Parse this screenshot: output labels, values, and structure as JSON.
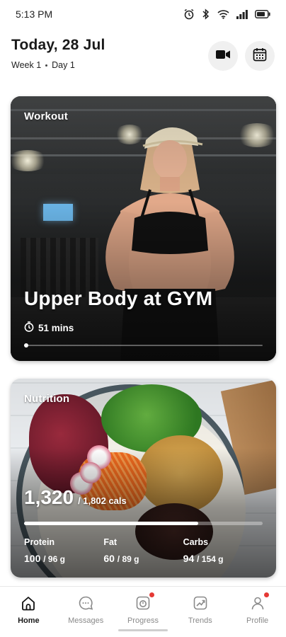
{
  "status_bar": {
    "time": "5:13 PM",
    "icons": [
      "alarm-icon",
      "bluetooth-icon",
      "wifi-icon",
      "cellular-signal-icon",
      "battery-icon"
    ]
  },
  "header": {
    "date": "Today, 28 Jul",
    "week": "Week 1",
    "day": "Day 1",
    "buttons": [
      "video-camera-icon",
      "calendar-icon"
    ]
  },
  "workout": {
    "label": "Workout",
    "title": "Upper Body at GYM",
    "duration": "51 mins"
  },
  "nutrition": {
    "label": "Nutrition",
    "calories": "1,320",
    "calories_target": "/ 1,802 cals",
    "calories_progress": 0.73,
    "macros": [
      {
        "name": "Protein",
        "value": "100",
        "target": "/ 96 g"
      },
      {
        "name": "Fat",
        "value": "60",
        "target": "/ 89 g"
      },
      {
        "name": "Carbs",
        "value": "94",
        "target": "/ 154 g"
      }
    ]
  },
  "nav": {
    "items": [
      {
        "label": "Home",
        "icon": "home-icon",
        "active": true,
        "badge": false
      },
      {
        "label": "Messages",
        "icon": "chat-bubble-icon",
        "active": false,
        "badge": false
      },
      {
        "label": "Progress",
        "icon": "progress-icon",
        "active": false,
        "badge": true
      },
      {
        "label": "Trends",
        "icon": "trend-chart-icon",
        "active": false,
        "badge": false
      },
      {
        "label": "Profile",
        "icon": "profile-icon",
        "active": false,
        "badge": true
      }
    ]
  },
  "colors": {
    "badge": "#e53935",
    "active_label": "#1a1a1a",
    "inactive_label": "#8a8a8a"
  }
}
